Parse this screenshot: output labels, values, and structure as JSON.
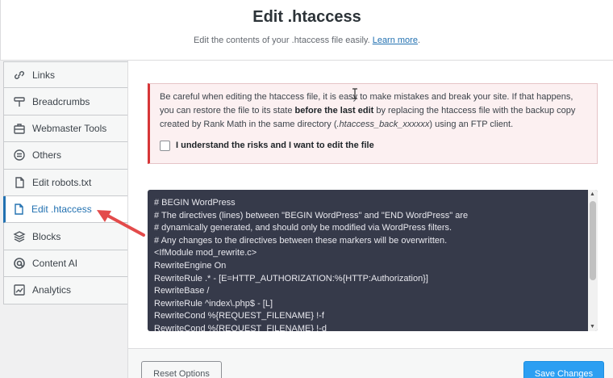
{
  "header": {
    "title": "Edit .htaccess",
    "subtitle": "Edit the contents of your .htaccess file easily.",
    "learn_more": "Learn more",
    "period": "."
  },
  "sidebar": {
    "items": [
      {
        "label": "Links",
        "icon": "links-icon"
      },
      {
        "label": "Breadcrumbs",
        "icon": "breadcrumbs-icon"
      },
      {
        "label": "Webmaster Tools",
        "icon": "webmaster-tools-icon"
      },
      {
        "label": "Others",
        "icon": "others-icon"
      },
      {
        "label": "Edit robots.txt",
        "icon": "file-icon"
      },
      {
        "label": "Edit .htaccess",
        "icon": "file-icon",
        "active": true
      },
      {
        "label": "Blocks",
        "icon": "blocks-icon"
      },
      {
        "label": "Content AI",
        "icon": "content-ai-icon"
      },
      {
        "label": "Analytics",
        "icon": "analytics-icon"
      }
    ]
  },
  "notice": {
    "text1": "Be careful when editing the htaccess file, it is easy to make mistakes and break your site. If that happens, you can restore the file to its state ",
    "bold": "before the last edit",
    "text2": " by replacing the htaccess file with the backup copy created by Rank Math in the same directory (",
    "italic": ".htaccess_back_xxxxxx",
    "text3": ") using an FTP client.",
    "checkbox_label": "I understand the risks and I want to edit the file",
    "checkbox_checked": false
  },
  "editor": {
    "lines": [
      "# BEGIN WordPress",
      "# The directives (lines) between \"BEGIN WordPress\" and \"END WordPress\" are",
      "# dynamically generated, and should only be modified via WordPress filters.",
      "# Any changes to the directives between these markers will be overwritten.",
      "<IfModule mod_rewrite.c>",
      "RewriteEngine On",
      "RewriteRule .* - [E=HTTP_AUTHORIZATION:%{HTTP:Authorization}]",
      "RewriteBase /",
      "RewriteRule ^index\\.php$ - [L]",
      "RewriteCond %{REQUEST_FILENAME} !-f",
      "RewriteCond %{REQUEST_FILENAME} !-d"
    ]
  },
  "footer": {
    "reset_label": "Reset Options",
    "save_label": "Save Changes"
  },
  "colors": {
    "accent": "#2271b1",
    "save_button": "#2c9ff2",
    "notice_border": "#d63638",
    "editor_bg": "#363a4a",
    "arrow": "#e34b4b"
  }
}
